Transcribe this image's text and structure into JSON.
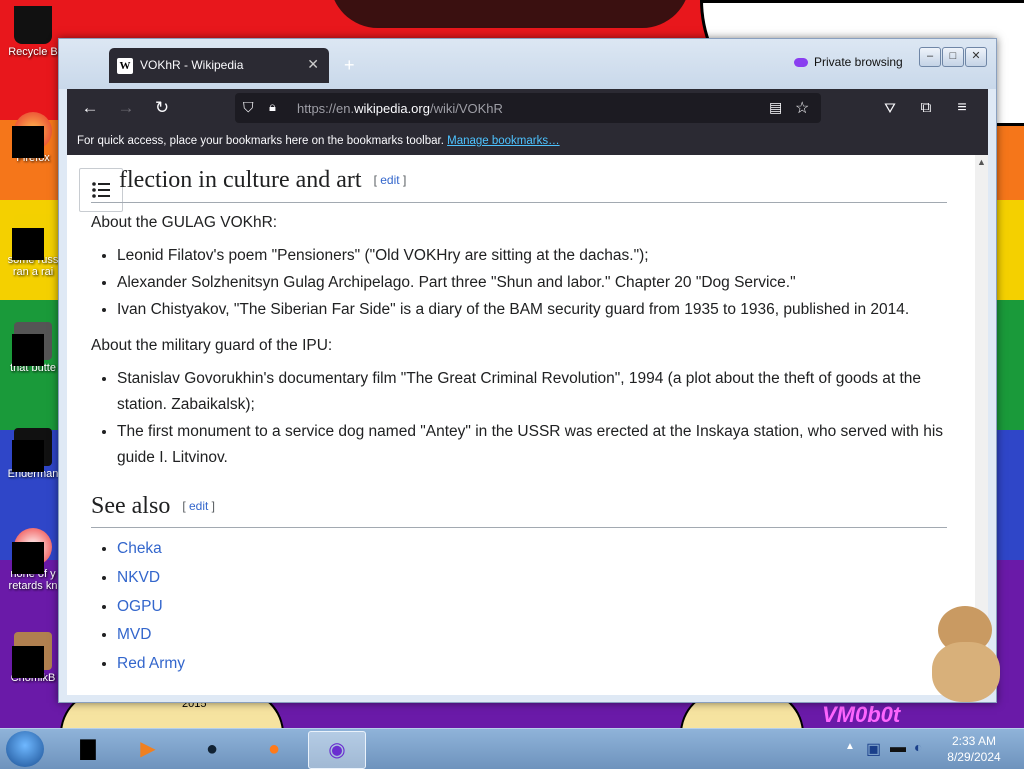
{
  "desktop": {
    "icons": [
      {
        "label": "Recycle B",
        "name": "recycle-bin-icon"
      },
      {
        "label": "Firefox",
        "name": "firefox-icon"
      },
      {
        "label": "some russ ran a rai",
        "name": "shortcut-icon"
      },
      {
        "label": "that butte",
        "name": "shortcut-icon"
      },
      {
        "label": "Enderman",
        "name": "shortcut-icon"
      },
      {
        "label": "none of y retards kn",
        "name": "shortcut-icon"
      },
      {
        "label": "ChomikB",
        "name": "shortcut-icon"
      }
    ],
    "watermark": "VM0b0t",
    "year_mark": "2015"
  },
  "browser": {
    "tab_title": "VOKhR - Wikipedia",
    "favicon_letter": "W",
    "private_label": "Private browsing",
    "url_prefix": "https://en.",
    "url_domain": "wikipedia.org",
    "url_path": "/wiki/VOKhR",
    "bookmarks_text": "For quick access, place your bookmarks here on the bookmarks toolbar.",
    "bookmarks_link": "Manage bookmarks…"
  },
  "article": {
    "section1_heading": "flection in culture and art",
    "edit_label": "edit",
    "para1": "About the GULAG VOKhR:",
    "list1": [
      "Leonid Filatov's poem \"Pensioners\" (\"Old VOKHry are sitting at the dachas.\");",
      "Alexander Solzhenitsyn Gulag Archipelago. Part three \"Shun and labor.\" Chapter 20 \"Dog Service.\"",
      "Ivan Chistyakov, \"The Siberian Far Side\" is a diary of the BAM security guard from 1935 to 1936, published in 2014."
    ],
    "para2": "About the military guard of the IPU:",
    "list2": [
      "Stanislav Govorukhin's documentary film \"The Great Criminal Revolution\", 1994 (a plot about the theft of goods at the station. Zabaikalsk);",
      "The first monument to a service dog named \"Antey\" in the USSR was erected at the Inskaya station, who served with his guide I. Litvinov."
    ],
    "section2_heading": "See also",
    "see_also": [
      "Cheka",
      "NKVD",
      "OGPU",
      "MVD",
      "Red Army"
    ]
  },
  "taskbar": {
    "time": "2:33 AM",
    "date": "8/29/2024"
  },
  "colors": {
    "link": "#3366cc",
    "toolbar": "#2b2a33",
    "private_accent": "#8a3ff0"
  }
}
